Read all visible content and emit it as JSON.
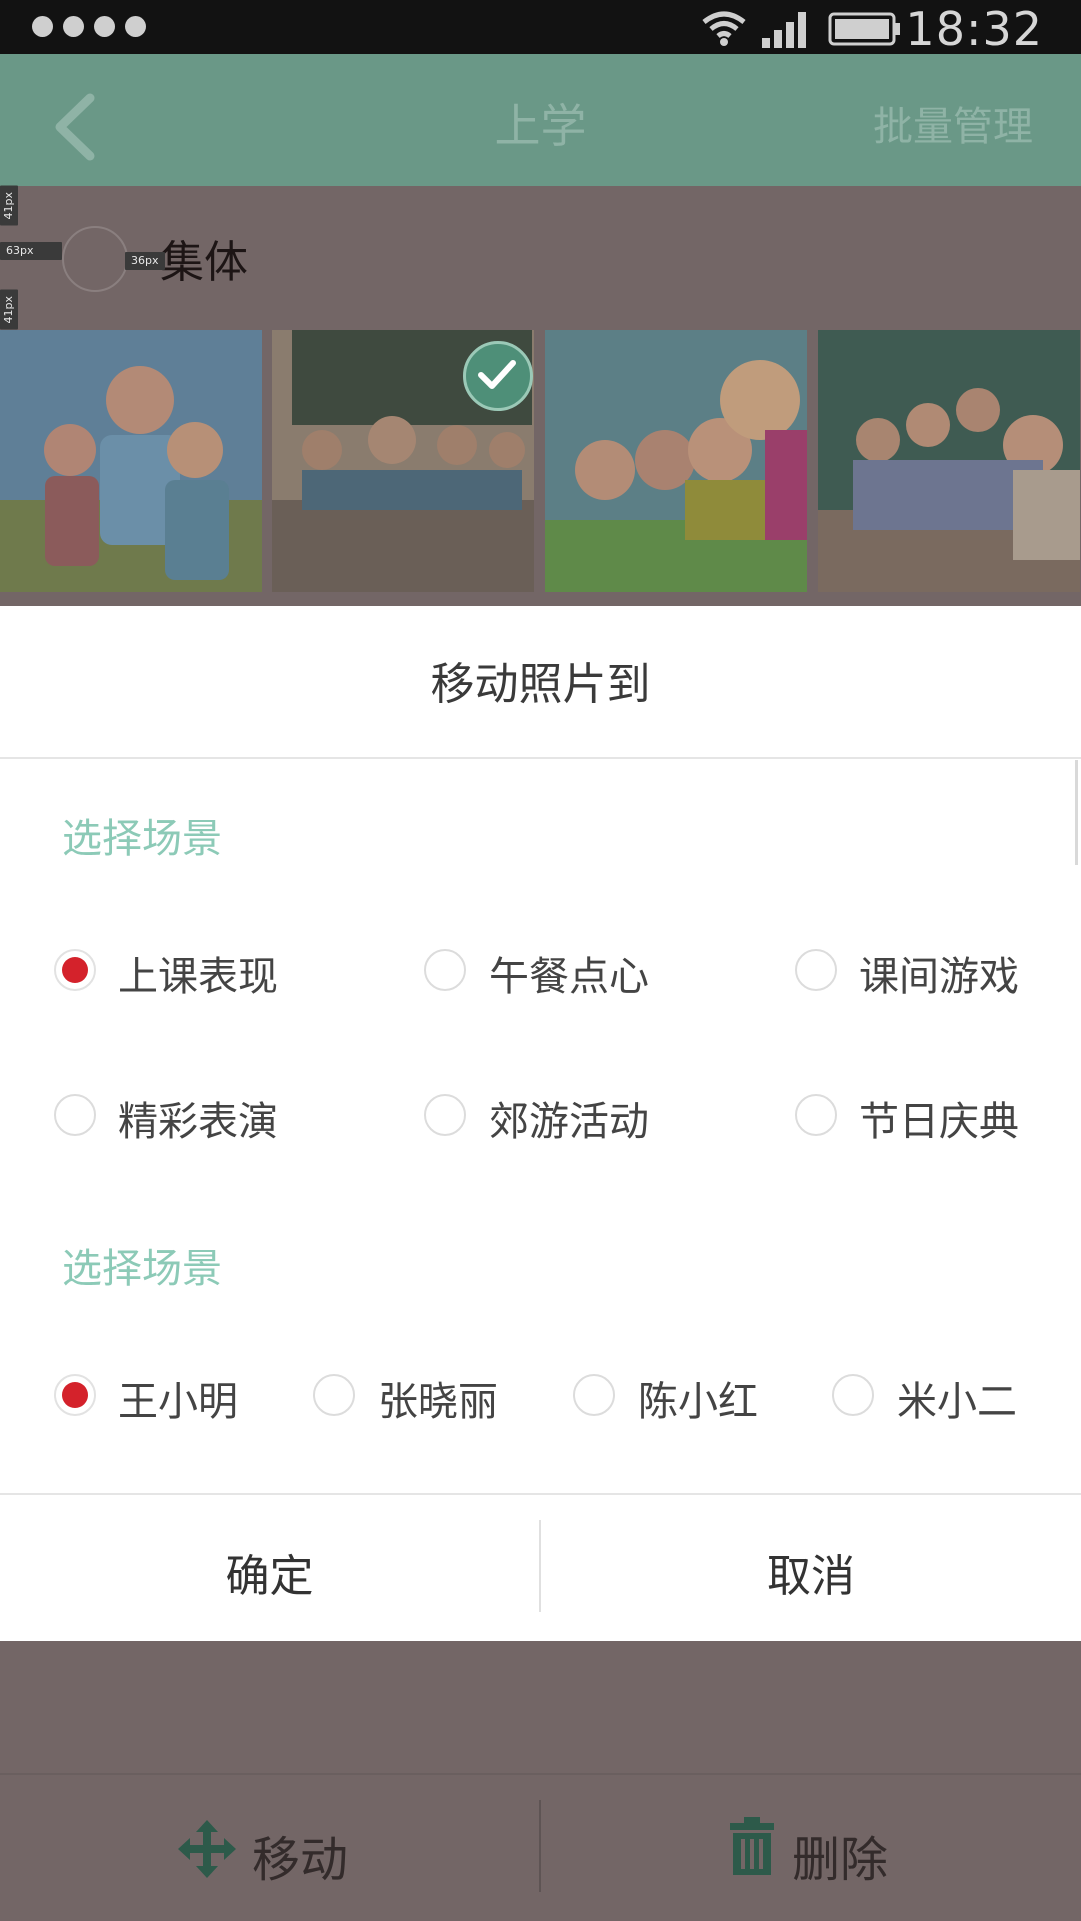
{
  "status_bar": {
    "time": "18:32"
  },
  "header": {
    "title": "上学",
    "action": "批量管理"
  },
  "section": {
    "title": "集体"
  },
  "measurements": {
    "m1": "41px",
    "m2": "63px",
    "m3": "36px",
    "m4": "41px",
    "m5": "52px",
    "m6": "63px",
    "m7": "63px"
  },
  "dialog": {
    "title": "移动照片到",
    "group1_label": "选择场景",
    "group1_options": [
      {
        "label": "上课表现",
        "selected": true
      },
      {
        "label": "午餐点心",
        "selected": false
      },
      {
        "label": "课间游戏",
        "selected": false
      },
      {
        "label": "精彩表演",
        "selected": false
      },
      {
        "label": "郊游活动",
        "selected": false
      },
      {
        "label": "节日庆典",
        "selected": false
      }
    ],
    "group2_label": "选择场景",
    "group2_options": [
      {
        "label": "王小明",
        "selected": true
      },
      {
        "label": "张晓丽",
        "selected": false
      },
      {
        "label": "陈小红",
        "selected": false
      },
      {
        "label": "米小二",
        "selected": false
      }
    ],
    "confirm": "确定",
    "cancel": "取消"
  },
  "toolbar": {
    "move": "移动",
    "delete": "删除"
  },
  "colors": {
    "accent": "#8ccab7",
    "selected": "#d4222b",
    "header": "#6a9887"
  },
  "icons": [
    "back-icon",
    "wifi-icon",
    "signal-icon",
    "battery-icon",
    "check-icon",
    "move-icon",
    "trash-icon"
  ]
}
